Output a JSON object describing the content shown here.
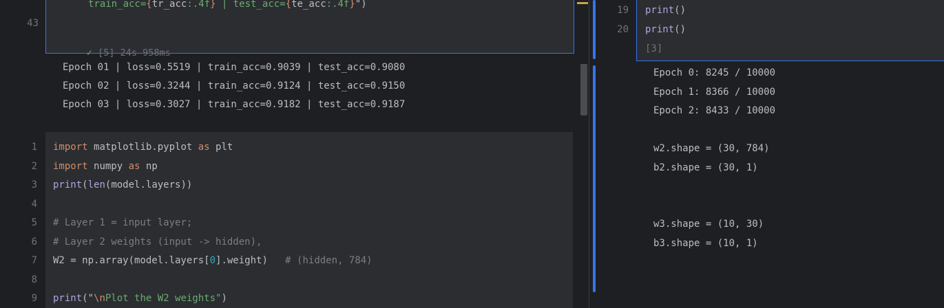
{
  "left": {
    "cell1": {
      "line_number": "43",
      "code_tokens": [
        {
          "t": "train_acc=",
          "c": "s"
        },
        {
          "t": "{",
          "c": "k"
        },
        {
          "t": "tr_acc",
          "c": "p"
        },
        {
          "t": ":.4f",
          "c": "s"
        },
        {
          "t": "}",
          "c": "k"
        },
        {
          "t": " | test_acc=",
          "c": "s"
        },
        {
          "t": "{",
          "c": "k"
        },
        {
          "t": "te_acc",
          "c": "p"
        },
        {
          "t": ":.4f",
          "c": "s"
        },
        {
          "t": "}",
          "c": "k"
        },
        {
          "t": "\")",
          "c": "p"
        }
      ],
      "status_icon": "checkmark-icon",
      "status": "[5] 24s 958ms"
    },
    "output1": [
      "Epoch 01 | loss=0.5519 | train_acc=0.9039 | test_acc=0.9080",
      "Epoch 02 | loss=0.3244 | train_acc=0.9124 | test_acc=0.9150",
      "Epoch 03 | loss=0.3027 | train_acc=0.9182 | test_acc=0.9187"
    ],
    "cell2": {
      "lines": [
        {
          "num": "1",
          "tokens": [
            {
              "t": "import ",
              "c": "k"
            },
            {
              "t": "matplotlib.pyplot ",
              "c": "p"
            },
            {
              "t": "as ",
              "c": "k"
            },
            {
              "t": "plt",
              "c": "p"
            }
          ]
        },
        {
          "num": "2",
          "tokens": [
            {
              "t": "import ",
              "c": "k"
            },
            {
              "t": "numpy ",
              "c": "p"
            },
            {
              "t": "as ",
              "c": "k"
            },
            {
              "t": "np",
              "c": "p"
            }
          ]
        },
        {
          "num": "3",
          "tokens": [
            {
              "t": "print",
              "c": "f"
            },
            {
              "t": "(",
              "c": "p"
            },
            {
              "t": "len",
              "c": "f"
            },
            {
              "t": "(model.layers))",
              "c": "p"
            }
          ]
        },
        {
          "num": "4",
          "tokens": []
        },
        {
          "num": "5",
          "tokens": [
            {
              "t": "# Layer 1 = input layer;",
              "c": "c"
            }
          ]
        },
        {
          "num": "6",
          "tokens": [
            {
              "t": "# Layer 2 weights (input -> hidden),",
              "c": "c"
            }
          ]
        },
        {
          "num": "7",
          "tokens": [
            {
              "t": "W2 = np.array(model.layers[",
              "c": "p"
            },
            {
              "t": "0",
              "c": "n"
            },
            {
              "t": "].weight)   ",
              "c": "p"
            },
            {
              "t": "# (hidden, 784)",
              "c": "c"
            }
          ]
        },
        {
          "num": "8",
          "tokens": []
        },
        {
          "num": "9",
          "tokens": [
            {
              "t": "print",
              "c": "f"
            },
            {
              "t": "(\"",
              "c": "p"
            },
            {
              "t": "\\n",
              "c": "k"
            },
            {
              "t": "Plot the W2 weights\"",
              "c": "s"
            },
            {
              "t": ")",
              "c": "p"
            }
          ]
        }
      ]
    }
  },
  "right": {
    "cell": {
      "lines": [
        {
          "num": "19",
          "tokens": [
            {
              "t": "print",
              "c": "f"
            },
            {
              "t": "()",
              "c": "p"
            }
          ]
        },
        {
          "num": "20",
          "tokens": [
            {
              "t": "print",
              "c": "f"
            },
            {
              "t": "()",
              "c": "p"
            }
          ]
        }
      ],
      "status": "[3]"
    },
    "output": [
      "Epoch 0: 8245 / 10000",
      "Epoch 1: 8366 / 10000",
      "Epoch 2: 8433 / 10000",
      "",
      "w2.shape = (30, 784)",
      "b2.shape = (30, 1)",
      "",
      "",
      "w3.shape = (10, 30)",
      "b3.shape = (10, 1)"
    ]
  },
  "colors": {
    "accent": "#3574f0",
    "cell_bg": "#2b2d30",
    "bg": "#1e1f22",
    "success": "#5fb865"
  }
}
